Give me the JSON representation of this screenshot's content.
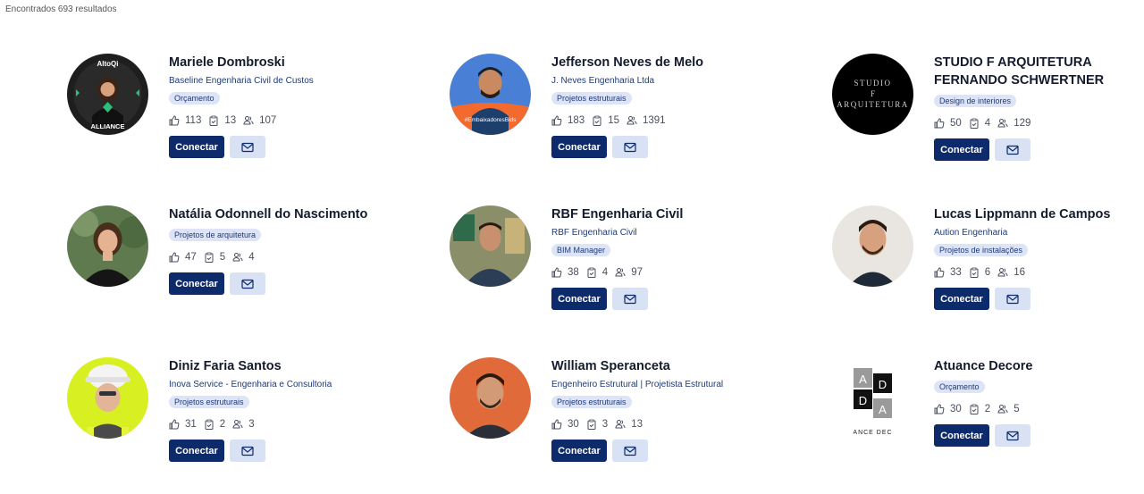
{
  "results_text": "Encontrados 693 resultados",
  "buttons": {
    "connect": "Conectar"
  },
  "cards": [
    {
      "name": "Mariele Dombroski",
      "company": "Baseline Engenharia Civil de Custos",
      "tag": "Orçamento",
      "likes": "113",
      "projects": "13",
      "followers": "107",
      "avatar_text_top": "AltoQi",
      "avatar_text_bottom": "ALLIANCE"
    },
    {
      "name": "Jefferson Neves de Melo",
      "company": "J. Neves Engenharia Ltda",
      "tag": "Projetos estruturais",
      "likes": "183",
      "projects": "15",
      "followers": "1391",
      "avatar_text_bottom": "#EmbaixadoresBids"
    },
    {
      "name": "STUDIO F ARQUITETURA FERNANDO SCHWERTNER",
      "company": "",
      "tag": "Design de interiores",
      "likes": "50",
      "projects": "4",
      "followers": "129",
      "avatar_lines": [
        "STUDIO",
        "F",
        "ARQUITETURA"
      ]
    },
    {
      "name": "Natália Odonnell do Nascimento",
      "company": "",
      "tag": "Projetos de arquitetura",
      "likes": "47",
      "projects": "5",
      "followers": "4"
    },
    {
      "name": "RBF Engenharia Civil",
      "company": "RBF Engenharia Civil",
      "tag": "BIM Manager",
      "likes": "38",
      "projects": "4",
      "followers": "97"
    },
    {
      "name": "Lucas Lippmann de Campos",
      "company": "Aution Engenharia",
      "tag": "Projetos de instalações",
      "likes": "33",
      "projects": "6",
      "followers": "16"
    },
    {
      "name": "Diniz Faria Santos",
      "company": "Inova Service - Engenharia e Consultoria",
      "tag": "Projetos estruturais",
      "likes": "31",
      "projects": "2",
      "followers": "3"
    },
    {
      "name": "William Speranceta",
      "company": "Engenheiro Estrutural | Projetista Estrutural",
      "tag": "Projetos estruturais",
      "likes": "30",
      "projects": "3",
      "followers": "13"
    },
    {
      "name": "Atuance Decore",
      "company": "",
      "tag": "Orçamento",
      "likes": "30",
      "projects": "2",
      "followers": "5",
      "avatar_letters": [
        "A",
        "D",
        "D",
        "A"
      ],
      "avatar_caption": "ANCE DEC"
    }
  ]
}
